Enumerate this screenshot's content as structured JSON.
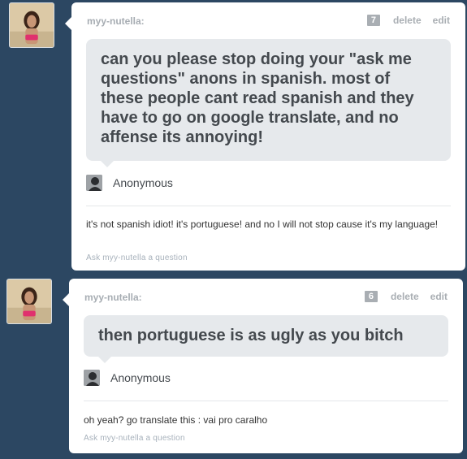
{
  "posts": [
    {
      "blog_name": "myy-nutella:",
      "note_count": "7",
      "delete_label": "delete",
      "edit_label": "edit",
      "question": "can you please stop doing your \"ask me questions\" anons in spanish. most of these people cant read spanish and they have to go on google translate, and no affense its annoying!",
      "asker": "Anonymous",
      "answer": "it's not spanish idiot! it's portuguese! and no I will not stop cause it's my language!",
      "ask_link": "Ask myy-nutella a question"
    },
    {
      "blog_name": "myy-nutella:",
      "note_count": "6",
      "delete_label": "delete",
      "edit_label": "edit",
      "question": "then portuguese is as ugly as you bitch",
      "asker": "Anonymous",
      "answer": "oh yeah? go translate this : vai pro caralho",
      "ask_link": "Ask myy-nutella a question"
    }
  ]
}
